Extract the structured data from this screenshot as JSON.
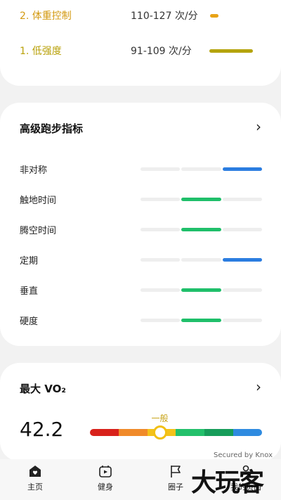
{
  "zones": [
    {
      "name": "2. 体重控制",
      "range": "110-127 次/分",
      "color": "#e8a317",
      "name_color": "#d39a12",
      "bar_fraction": 0.06
    },
    {
      "name": "1. 低强度",
      "range": "91-109 次/分",
      "color": "#b5a40e",
      "name_color": "#b9a10a",
      "bar_fraction": 0.6
    }
  ],
  "advanced": {
    "title": "高级跑步指标",
    "metrics": [
      {
        "label": "非对称",
        "level": 3,
        "color": "#2b7de0"
      },
      {
        "label": "触地时间",
        "level": 2,
        "color": "#1fbf6a"
      },
      {
        "label": "腾空时间",
        "level": 2,
        "color": "#1fbf6a"
      },
      {
        "label": "定期",
        "level": 3,
        "color": "#2b7de0"
      },
      {
        "label": "垂直",
        "level": 2,
        "color": "#1fbf6a"
      },
      {
        "label": "硬度",
        "level": 2,
        "color": "#1fbf6a"
      }
    ]
  },
  "vo2": {
    "title": "最大 VO₂",
    "value": "42.2",
    "level_label": "一般",
    "marker_fraction": 0.41,
    "scale_colors": [
      "#d8211b",
      "#f08a2a",
      "#f4c21a",
      "#23c06b",
      "#179d5a",
      "#2f8be0"
    ]
  },
  "secured_text": "Secured by Knox",
  "nav": [
    {
      "label": "主页",
      "icon": "home-heart-icon"
    },
    {
      "label": "健身",
      "icon": "fitness-play-icon"
    },
    {
      "label": "圈子",
      "icon": "flag-icon"
    },
    {
      "label": "我的页面",
      "icon": "person-icon"
    }
  ],
  "watermark": "大玩客"
}
